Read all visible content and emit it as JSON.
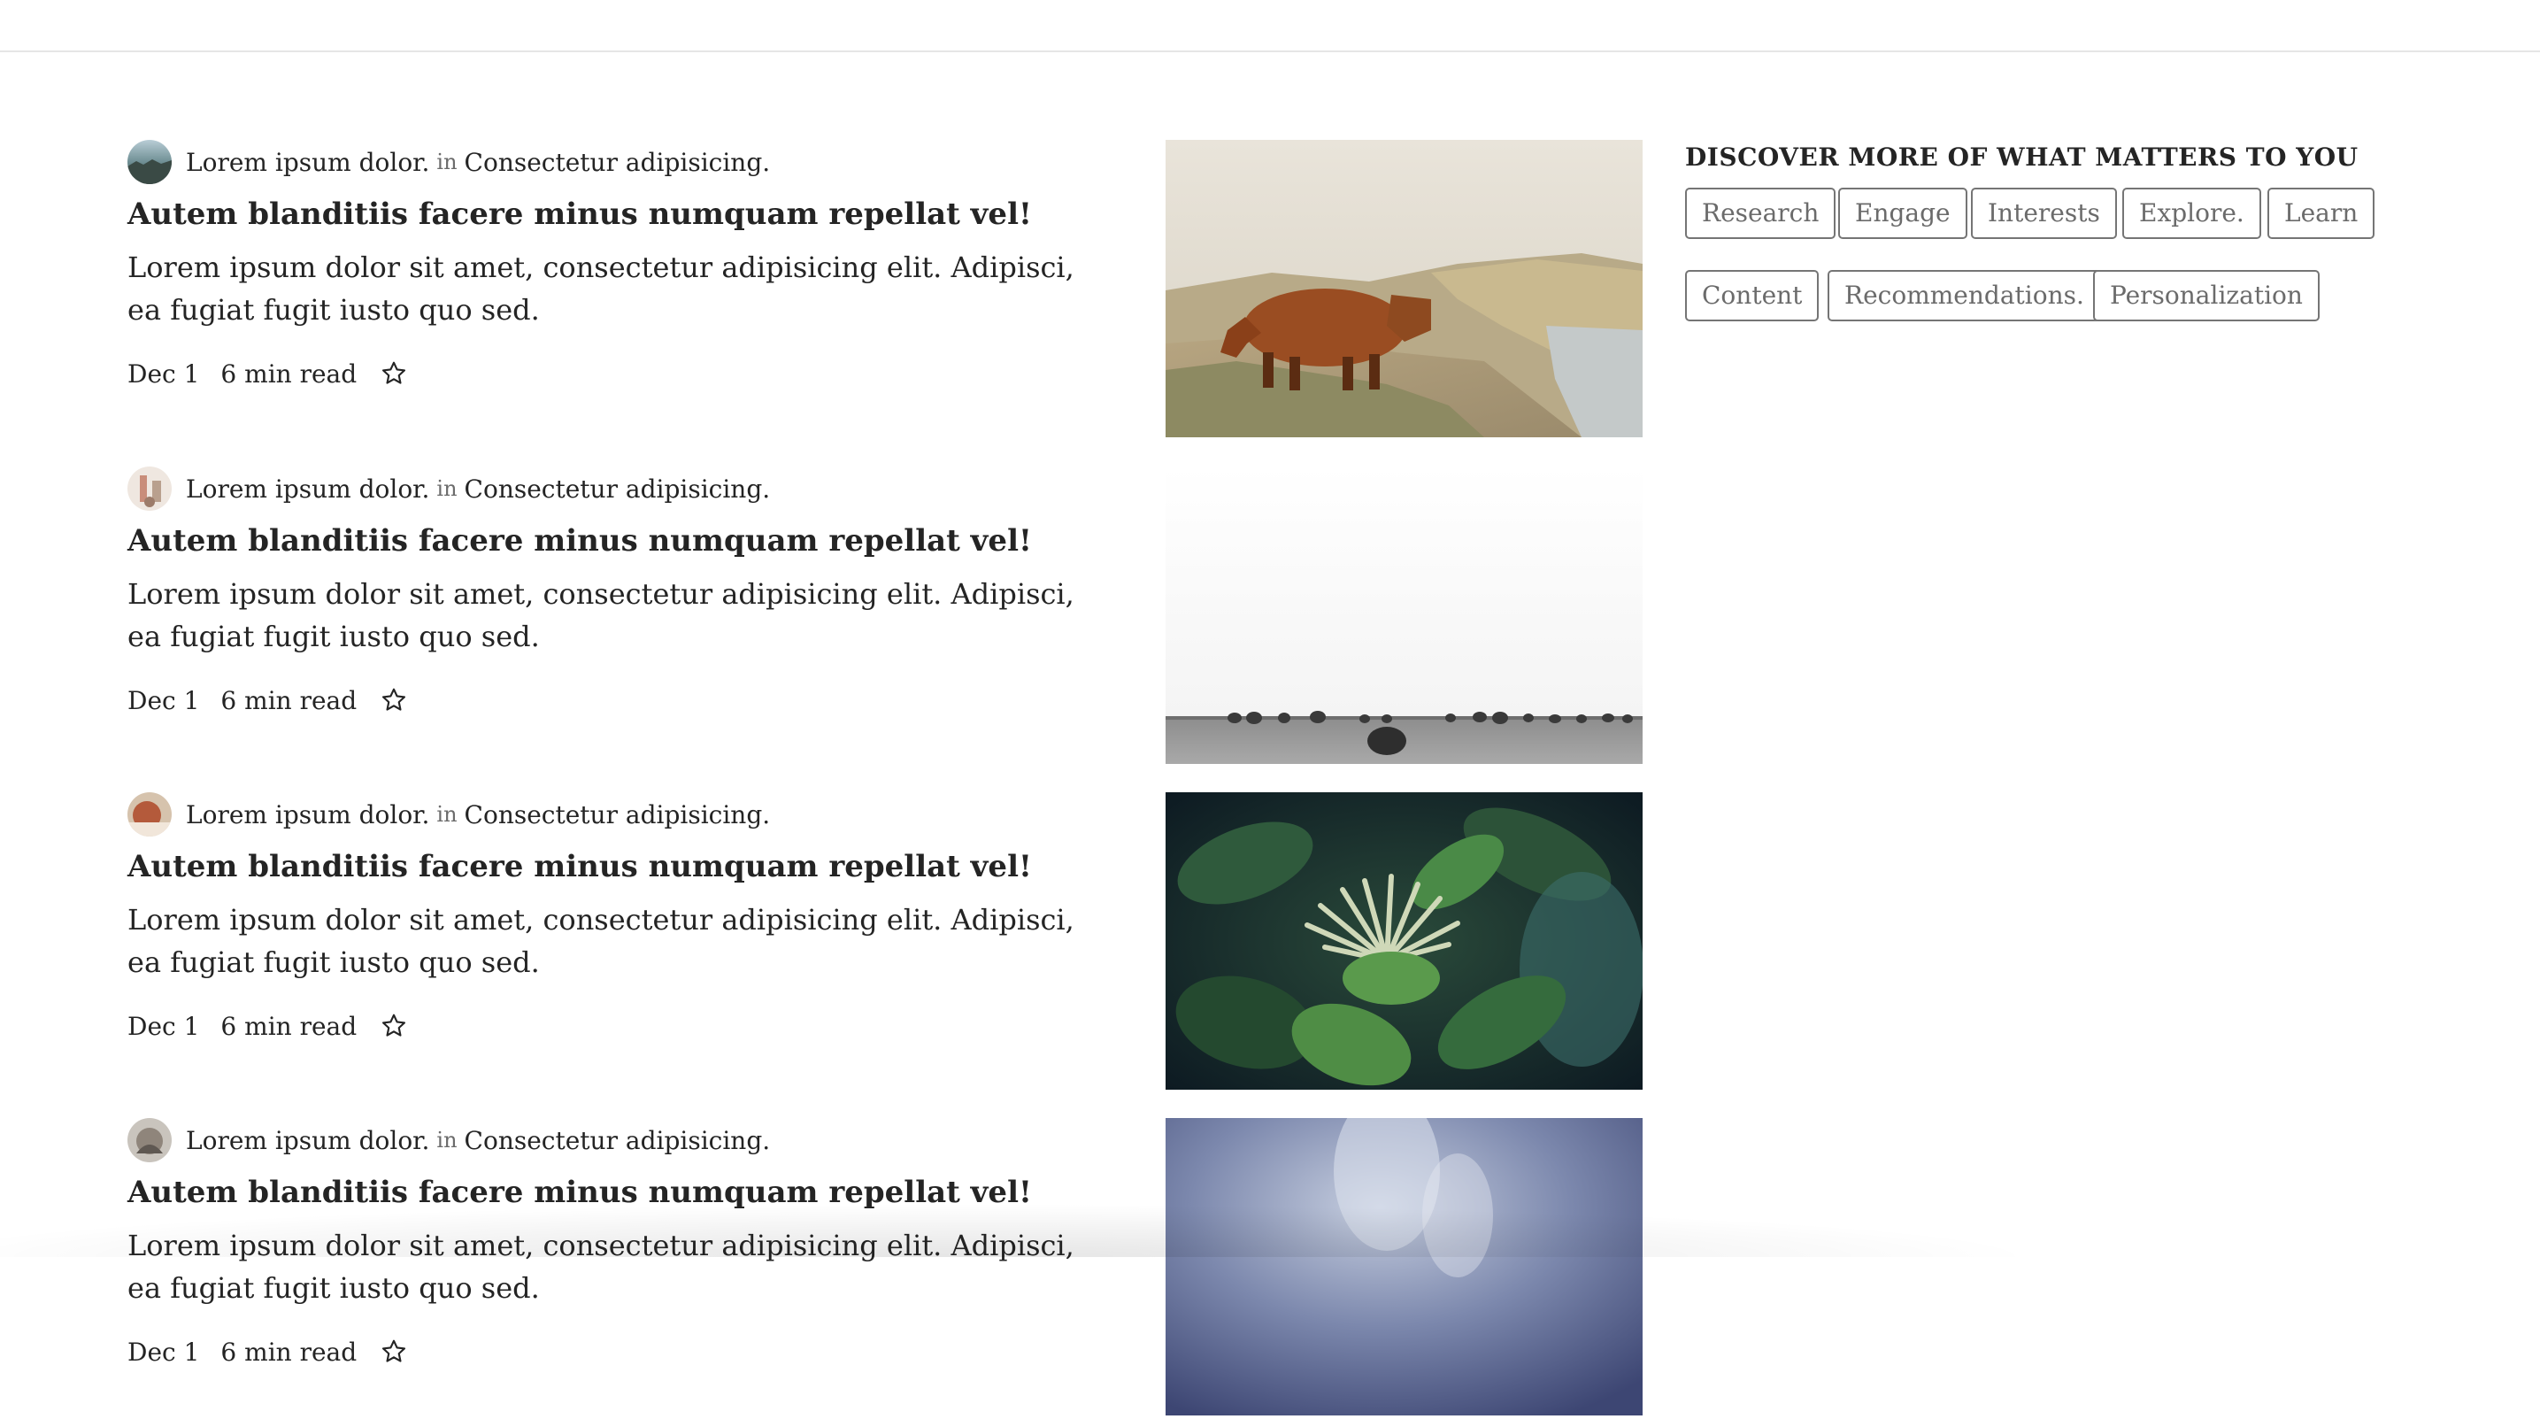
{
  "posts": [
    {
      "author": "Lorem ipsum dolor.",
      "in_label": "in",
      "publication": "Consectetur adipisicing.",
      "title": "Autem blanditiis facere minus numquam repellat vel!",
      "excerpt": "Lorem ipsum dolor sit amet, consectetur adipisicing elit. Adipisci, ea fugiat fugit iusto quo sed.",
      "date": "Dec 1",
      "read_time": "6 min read",
      "image": "highland-cow-photo"
    },
    {
      "author": "Lorem ipsum dolor.",
      "in_label": "in",
      "publication": "Consectetur adipisicing.",
      "title": "Autem blanditiis facere minus numquam repellat vel!",
      "excerpt": "Lorem ipsum dolor sit amet, consectetur adipisicing elit. Adipisci, ea fugiat fugit iusto quo sed.",
      "date": "Dec 1",
      "read_time": "6 min read",
      "image": "hay-bales-field-photo"
    },
    {
      "author": "Lorem ipsum dolor.",
      "in_label": "in",
      "publication": "Consectetur adipisicing.",
      "title": "Autem blanditiis facere minus numquam repellat vel!",
      "excerpt": "Lorem ipsum dolor sit amet, consectetur adipisicing elit. Adipisci, ea fugiat fugit iusto quo sed.",
      "date": "Dec 1",
      "read_time": "6 min read",
      "image": "green-plant-photo"
    },
    {
      "author": "Lorem ipsum dolor.",
      "in_label": "in",
      "publication": "Consectetur adipisicing.",
      "title": "Autem blanditiis facere minus numquam repellat vel!",
      "excerpt": "Lorem ipsum dolor sit amet, consectetur adipisicing elit. Adipisci, ea fugiat fugit iusto quo sed.",
      "date": "Dec 1",
      "read_time": "6 min read",
      "image": "cloudy-sky-photo"
    }
  ],
  "sidebar": {
    "title": "DISCOVER MORE OF WHAT MATTERS TO YOU",
    "tags": [
      "Research",
      "Engage",
      "Interests",
      "Explore.",
      "Learn",
      "Content",
      "Recommendations.",
      "Personalization"
    ]
  },
  "icons": {
    "bookmark": "star-icon"
  },
  "colors": {
    "text": "#242424",
    "muted": "#6b6b6b",
    "tag_border": "#757575",
    "divider": "#e6e6e6"
  }
}
